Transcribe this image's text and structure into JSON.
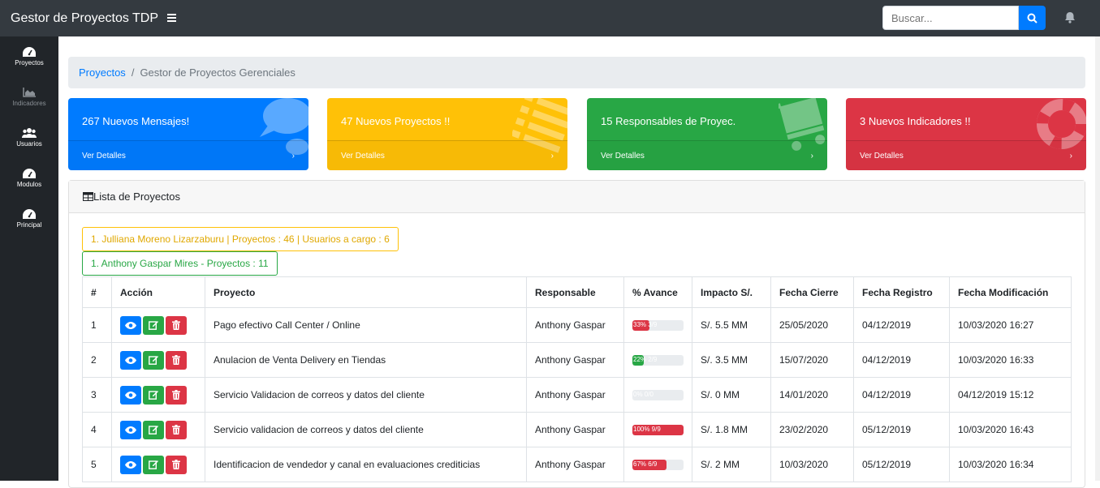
{
  "app": {
    "title": "Gestor de Proyectos TDP"
  },
  "search": {
    "placeholder": "Buscar..."
  },
  "sidebar": {
    "items": [
      {
        "label": "Proyectos",
        "icon": "tachometer-icon",
        "active": true
      },
      {
        "label": "Indicadores",
        "icon": "area-chart-icon",
        "active": false
      },
      {
        "label": "Usuarios",
        "icon": "users-icon",
        "active": true
      },
      {
        "label": "Modulos",
        "icon": "tachometer-icon",
        "active": true
      },
      {
        "label": "Principal",
        "icon": "tachometer-icon",
        "active": true
      }
    ]
  },
  "breadcrumb": {
    "root": "Proyectos",
    "current": "Gestor de Proyectos Gerenciales"
  },
  "cards": [
    {
      "title": "267 Nuevos Mensajes!",
      "link": "Ver Detalles",
      "color": "#007bff",
      "icon": "comments-icon"
    },
    {
      "title": "47 Nuevos Proyectos !!",
      "link": "Ver Detalles",
      "color": "#ffc107",
      "icon": "list-icon"
    },
    {
      "title": "15 Responsables de Proyec.",
      "link": "Ver Detalles",
      "color": "#28a745",
      "icon": "shopping-cart-icon"
    },
    {
      "title": "3 Nuevos Indicadores !!",
      "link": "Ver Detalles",
      "color": "#dc3545",
      "icon": "life-ring-icon"
    }
  ],
  "panel": {
    "title": "Lista de Proyectos"
  },
  "alerts": [
    "1. Julliana Moreno Lizarzaburu | Proyectos : 46 | Usuarios a cargo : 6",
    "1. Anthony Gaspar Mires - Proyectos : 11"
  ],
  "table": {
    "headers": [
      "#",
      "Acción",
      "Proyecto",
      "Responsable",
      "% Avance",
      "Impacto S/.",
      "Fecha Cierre",
      "Fecha Registro",
      "Fecha Modificación"
    ],
    "rows": [
      {
        "num": "1",
        "proyecto": "Pago efectivo Call Center / Online",
        "responsable": "Anthony Gaspar",
        "avance_label": "33% 3/9",
        "avance": 0.33,
        "avance_color": "#dc3545",
        "impacto": "S/. 5.5 MM",
        "cierre": "25/05/2020",
        "registro": "04/12/2019",
        "modificacion": "10/03/2020 16:27"
      },
      {
        "num": "2",
        "proyecto": "Anulacion de Venta Delivery en Tiendas",
        "responsable": "Anthony Gaspar",
        "avance_label": "22% 2/9",
        "avance": 0.22,
        "avance_color": "#28a745",
        "impacto": "S/. 3.5 MM",
        "cierre": "15/07/2020",
        "registro": "04/12/2019",
        "modificacion": "10/03/2020 16:33"
      },
      {
        "num": "3",
        "proyecto": "Servicio Validacion de correos y datos del cliente",
        "responsable": "Anthony Gaspar",
        "avance_label": "0% 0/0",
        "avance": 0,
        "avance_color": "#dc3545",
        "impacto": "S/. 0 MM",
        "cierre": "14/01/2020",
        "registro": "04/12/2019",
        "modificacion": "04/12/2019 15:12"
      },
      {
        "num": "4",
        "proyecto": "Servicio validacion de correos y datos del cliente",
        "responsable": "Anthony Gaspar",
        "avance_label": "100% 9/9",
        "avance": 1.0,
        "avance_color": "#dc3545",
        "impacto": "S/. 1.8 MM",
        "cierre": "23/02/2020",
        "registro": "05/12/2019",
        "modificacion": "10/03/2020 16:43"
      },
      {
        "num": "5",
        "proyecto": "Identificacion de vendedor y canal en evaluaciones crediticias",
        "responsable": "Anthony Gaspar",
        "avance_label": "67% 6/9",
        "avance": 0.67,
        "avance_color": "#dc3545",
        "impacto": "S/. 2 MM",
        "cierre": "10/03/2020",
        "registro": "05/12/2019",
        "modificacion": "10/03/2020 16:34"
      }
    ]
  }
}
